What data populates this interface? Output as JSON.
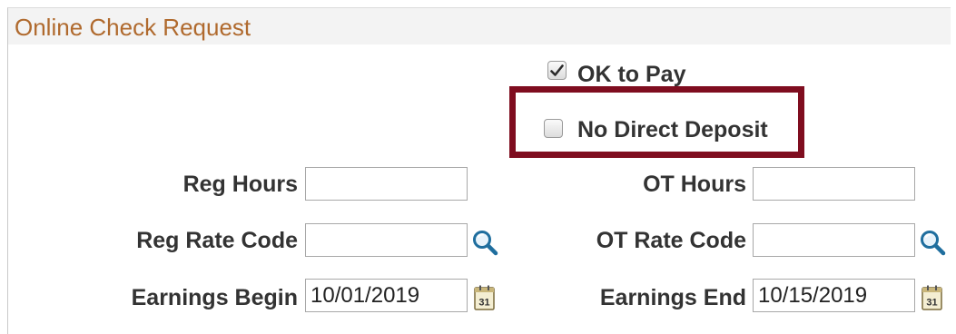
{
  "panel": {
    "title": "Online Check Request"
  },
  "ok_to_pay": {
    "label": "OK to Pay",
    "checked": true
  },
  "no_direct_deposit": {
    "label": "No Direct Deposit",
    "checked": false
  },
  "fields": {
    "reg_hours": {
      "label": "Reg Hours",
      "value": ""
    },
    "ot_hours": {
      "label": "OT Hours",
      "value": ""
    },
    "reg_rate_code": {
      "label": "Reg Rate Code",
      "value": "",
      "icon": "search-icon"
    },
    "ot_rate_code": {
      "label": "OT Rate Code",
      "value": "",
      "icon": "search-icon"
    },
    "earnings_begin": {
      "label": "Earnings Begin",
      "value": "10/01/2019",
      "icon": "calendar-icon"
    },
    "earnings_end": {
      "label": "Earnings End",
      "value": "10/15/2019",
      "icon": "calendar-icon"
    }
  },
  "icons": {
    "calendar_day": "31"
  },
  "colors": {
    "title": "#b06a2e",
    "highlight_border": "#7f0d1f",
    "label_text": "#333333"
  }
}
